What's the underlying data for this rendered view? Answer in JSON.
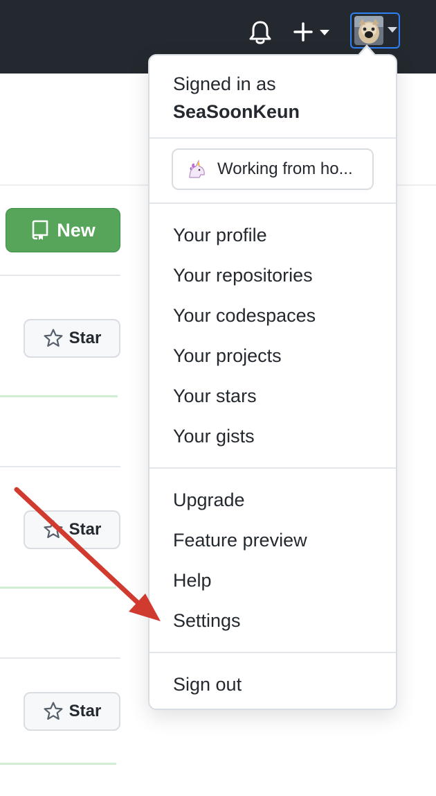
{
  "header": {
    "notifications_icon": "bell-icon",
    "create_icon": "plus-icon",
    "avatar_icon": "avatar",
    "accent": "#2f81f7",
    "background": "#24292f"
  },
  "repos": {
    "new_button_label": "New",
    "new_button_color": "#56a55a",
    "star_label": "Star"
  },
  "dropdown": {
    "signed_in_label": "Signed in as",
    "username": "SeaSoonKeun",
    "status": {
      "emoji": "unicorn-icon",
      "text": "Working from ho..."
    },
    "section_profile": [
      "Your profile",
      "Your repositories",
      "Your codespaces",
      "Your projects",
      "Your stars",
      "Your gists"
    ],
    "section_misc": [
      "Upgrade",
      "Feature preview",
      "Help",
      "Settings"
    ],
    "sign_out": "Sign out"
  },
  "annotation": {
    "arrow_color": "#d03a2f",
    "points_to": "Settings"
  }
}
